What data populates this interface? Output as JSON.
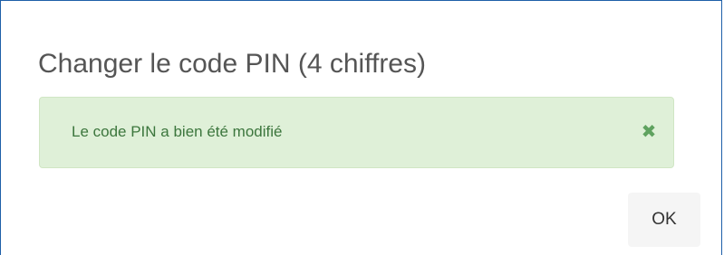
{
  "dialog": {
    "title": "Changer le code PIN (4 chiffres)",
    "alert": {
      "message": "Le code PIN a bien été modifié",
      "close_icon": "close-icon",
      "close_glyph": "✖",
      "type": "success",
      "background_color": "#dff0d8",
      "text_color": "#3c763d"
    },
    "ok_label": "OK",
    "border_color": "#1e5fa8"
  }
}
